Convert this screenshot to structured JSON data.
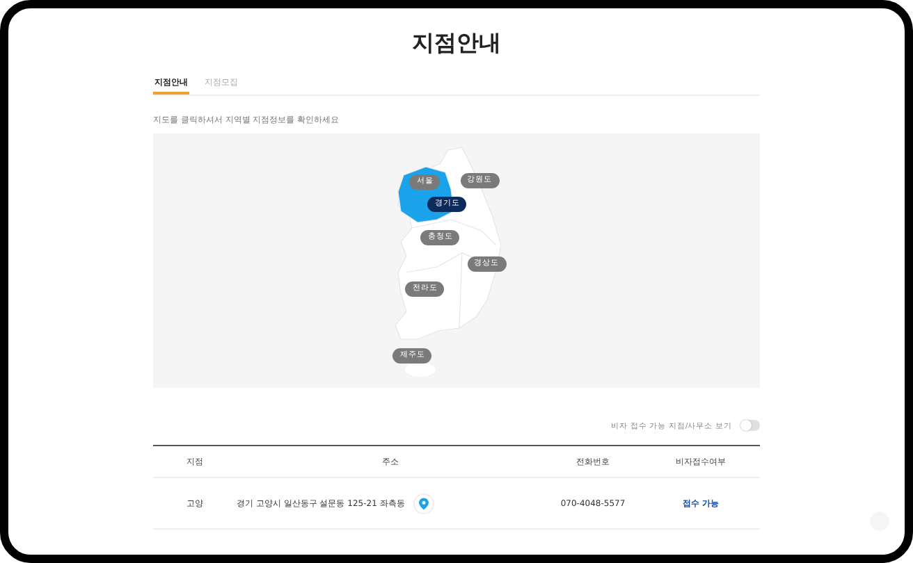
{
  "title": "지점안내",
  "tabs": [
    {
      "label": "지점안내",
      "selected": true
    },
    {
      "label": "지점모집",
      "selected": false
    }
  ],
  "instruction": "지도를 클릭하셔서 지역별 지점정보를 확인하세요",
  "map": {
    "regions": [
      {
        "label": "서울",
        "selected": false
      },
      {
        "label": "강원도",
        "selected": false
      },
      {
        "label": "경기도",
        "selected": true
      },
      {
        "label": "충청도",
        "selected": false
      },
      {
        "label": "경상도",
        "selected": false
      },
      {
        "label": "전라도",
        "selected": false
      },
      {
        "label": "제주도",
        "selected": false
      }
    ]
  },
  "visa_filter": {
    "label": "비자 접수 가능 지점/사무소 보기",
    "on": false
  },
  "table": {
    "columns": [
      "지점",
      "주소",
      "전화번호",
      "비자접수여부"
    ],
    "rows": [
      {
        "branch": "고양",
        "address": "경기 고양시 일산동구 설문동 125-21 좌측동",
        "phone": "070-4048-5577",
        "visa": "접수 가능"
      }
    ]
  }
}
